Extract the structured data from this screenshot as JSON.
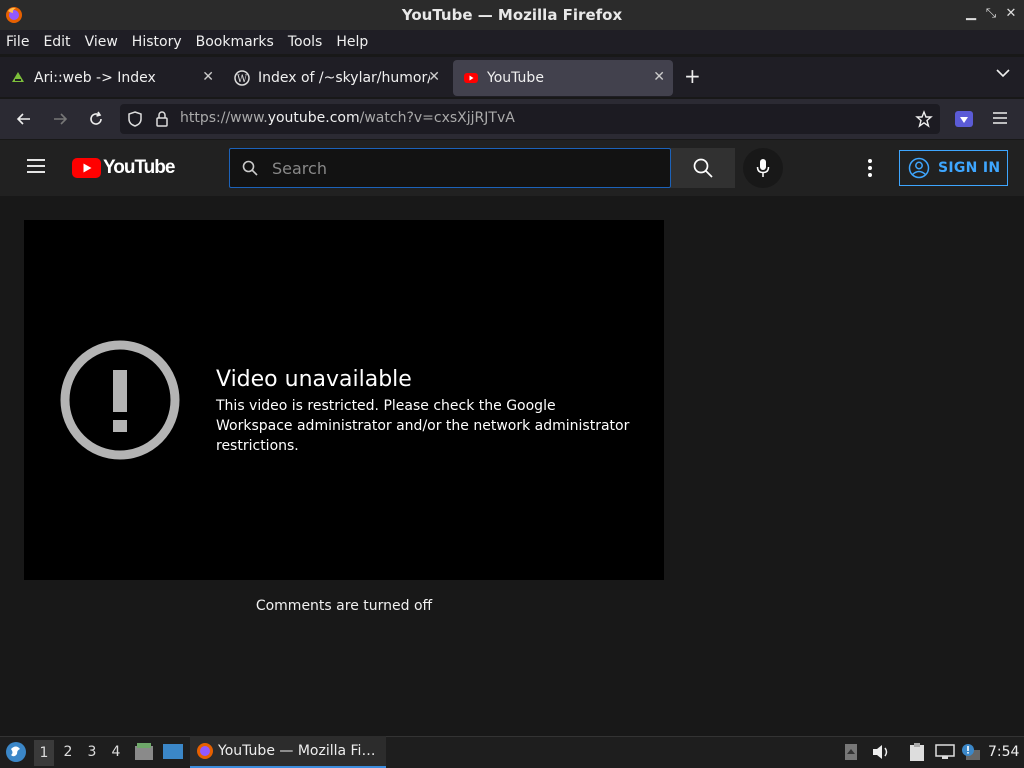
{
  "window": {
    "title": "YouTube — Mozilla Firefox"
  },
  "menu": [
    "File",
    "Edit",
    "View",
    "History",
    "Bookmarks",
    "Tools",
    "Help"
  ],
  "tabs": [
    {
      "label": "Ari::web -> Index"
    },
    {
      "label": "Index of /~skylar/humor/"
    },
    {
      "label": "YouTube"
    }
  ],
  "url": {
    "prefix": "https://www.",
    "domain": "youtube.com",
    "path": "/watch?v=cxsXjjRJTvA"
  },
  "youtube": {
    "logo_text": "YouTube",
    "search_placeholder": "Search",
    "sign_in": "SIGN IN",
    "error_title": "Video unavailable",
    "error_message": "This video is restricted. Please check the Google Workspace administrator and/or the network administrator restrictions.",
    "comments_status": "Comments are turned off"
  },
  "taskbar": {
    "workspaces": [
      "1",
      "2",
      "3",
      "4"
    ],
    "task_label": "YouTube — Mozilla Fi…",
    "clock": "7:54"
  },
  "colors": {
    "accent": "#3ea6ff",
    "yt_red": "#ff0000",
    "bg": "#181818"
  }
}
